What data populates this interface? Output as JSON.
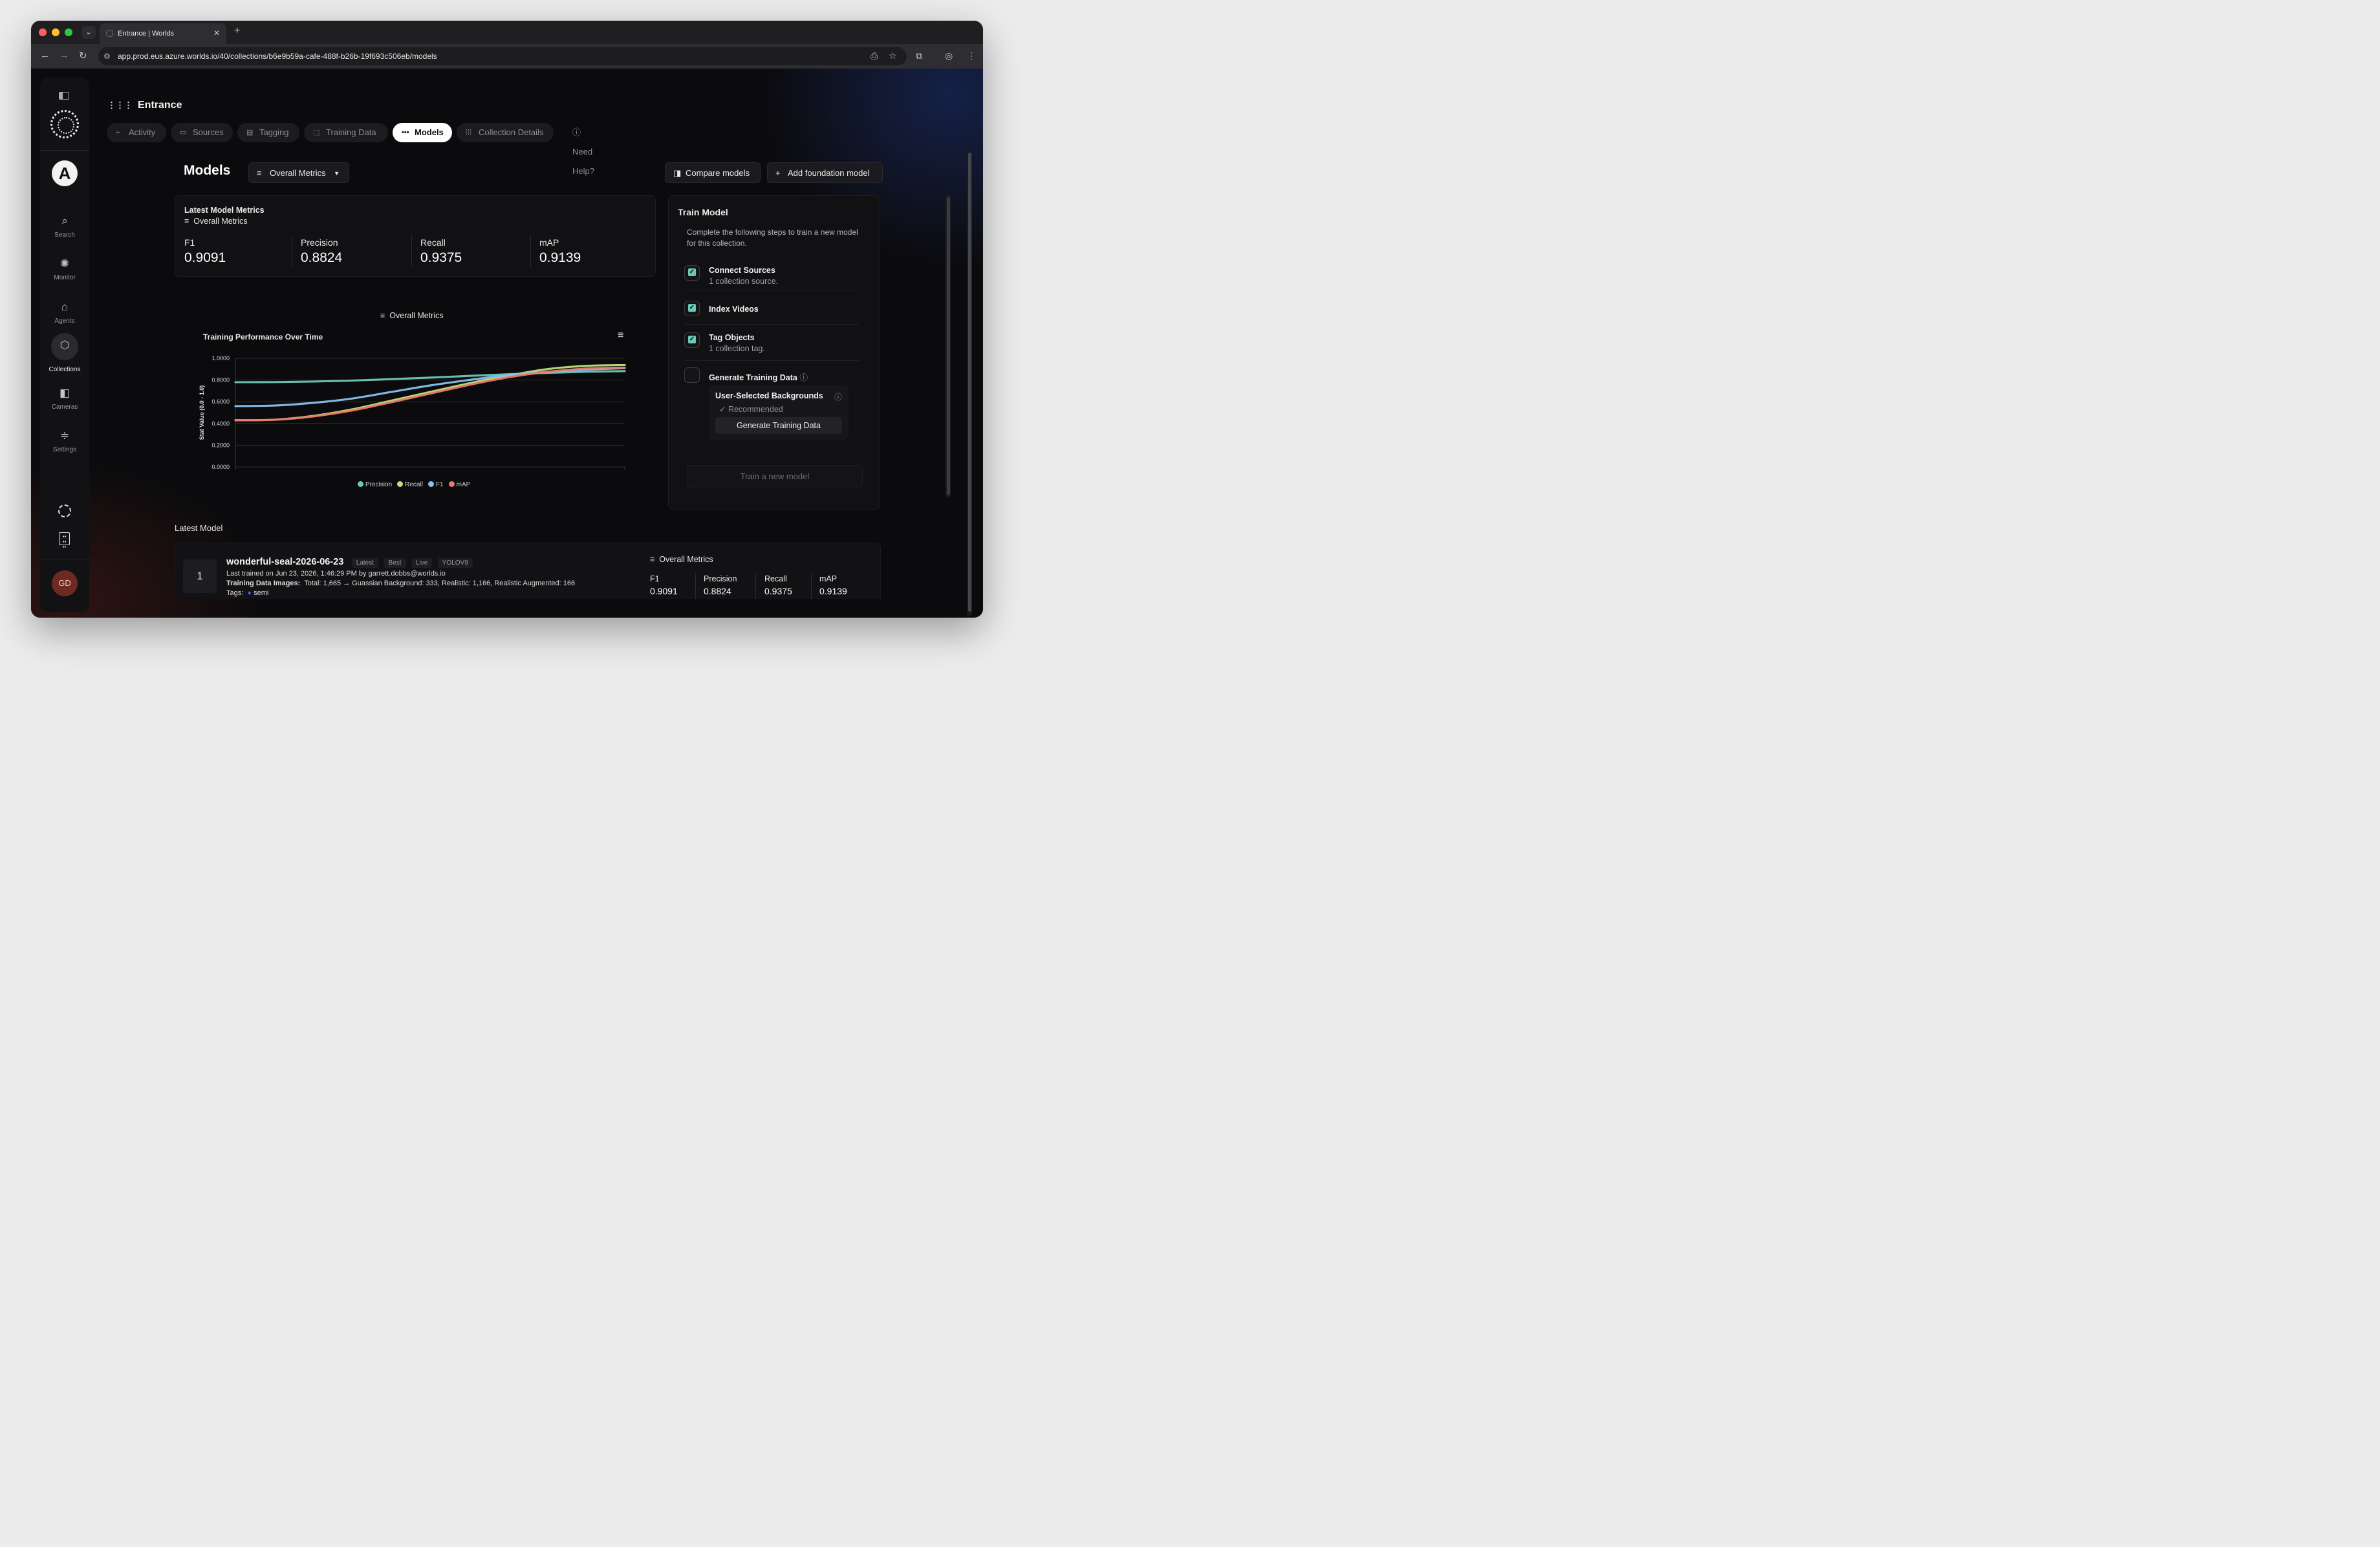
{
  "browser": {
    "tab_title": "Entrance | Worlds",
    "url": "app.prod.eus.azure.worlds.io/40/collections/b6e9b59a-cafe-488f-b26b-19f693c506eb/models"
  },
  "sidebar": {
    "items": [
      {
        "label": "Search"
      },
      {
        "label": "Monitor"
      },
      {
        "label": "Agents"
      },
      {
        "label": "Collections"
      },
      {
        "label": "Cameras"
      },
      {
        "label": "Settings"
      }
    ],
    "workspace_avatar": "A",
    "user_initials": "GD"
  },
  "app": {
    "title": "Entrance",
    "tabs": [
      "Activity",
      "Sources",
      "Tagging",
      "Training Data",
      "Models",
      "Collection Details"
    ],
    "active_tab": "Models",
    "help": "Need Help?"
  },
  "models": {
    "heading": "Models",
    "metrics_select": "Overall Metrics",
    "compare_button": "Compare models",
    "add_button": "Add foundation model"
  },
  "latest_metrics": {
    "title": "Latest Model Metrics",
    "subtitle": "Overall Metrics",
    "items": [
      {
        "label": "F1",
        "value": "0.9091"
      },
      {
        "label": "Precision",
        "value": "0.8824"
      },
      {
        "label": "Recall",
        "value": "0.9375"
      },
      {
        "label": "mAP",
        "value": "0.9139"
      }
    ]
  },
  "chart_header": "Overall Metrics",
  "chart_data": {
    "type": "line",
    "title": "Training Performance Over Time",
    "ylabel": "Stat Value (0.0 - 1.0)",
    "ylim": [
      0,
      1
    ],
    "yticks": [
      "1.0000",
      "0.8000",
      "0.6000",
      "0.4000",
      "0.2000",
      "0.0000"
    ],
    "x": [
      0,
      0.1,
      0.2,
      0.3,
      0.4,
      0.5,
      0.6,
      0.7,
      0.8,
      0.9,
      1.0
    ],
    "legend_position": "bottom",
    "grid": true,
    "series": [
      {
        "name": "Precision",
        "color": "#6fc7b7",
        "values": [
          0.78,
          0.781,
          0.786,
          0.795,
          0.808,
          0.822,
          0.838,
          0.853,
          0.866,
          0.876,
          0.882
        ]
      },
      {
        "name": "Recall",
        "color": "#bfe07a",
        "values": [
          0.43,
          0.435,
          0.47,
          0.53,
          0.61,
          0.69,
          0.77,
          0.84,
          0.9,
          0.93,
          0.938
        ]
      },
      {
        "name": "F1",
        "color": "#86c1ef",
        "values": [
          0.56,
          0.565,
          0.59,
          0.63,
          0.69,
          0.75,
          0.8,
          0.845,
          0.875,
          0.895,
          0.909
        ]
      },
      {
        "name": "mAP",
        "color": "#ea7a6c",
        "values": [
          0.43,
          0.434,
          0.465,
          0.52,
          0.595,
          0.675,
          0.755,
          0.825,
          0.875,
          0.905,
          0.914
        ]
      }
    ]
  },
  "train_model": {
    "title": "Train Model",
    "description": "Complete the following steps to train a new model for this collection.",
    "steps": [
      {
        "title": "Connect Sources",
        "subtitle": "1 collection source.",
        "done": true
      },
      {
        "title": "Index Videos",
        "subtitle": "",
        "done": true
      },
      {
        "title": "Tag Objects",
        "subtitle": "1 collection tag.",
        "done": true
      },
      {
        "title": "Generate Training Data",
        "subtitle": "",
        "done": false
      }
    ],
    "backgrounds_title": "User-Selected Backgrounds",
    "recommended": "Recommended",
    "generate_button": "Generate Training Data",
    "train_button": "Train a new model"
  },
  "latest_model": {
    "section_title": "Latest Model",
    "rank": "1",
    "name": "wonderful-seal-2026-06-23",
    "badges": [
      "Latest",
      "Best",
      "Live",
      "YOLOV9"
    ],
    "last_trained": "Last trained on Jun 23, 2026, 1:46:29 PM by garrett.dobbs@worlds.io",
    "training_images_label": "Training Data Images:",
    "training_images": "Total: 1,665 → Guassian Background: 333, Realistic: 1,166, Realistic Augmented: 166",
    "tags_label": "Tags:",
    "tag": "semi",
    "metrics_title": "Overall Metrics",
    "metrics": [
      {
        "label": "F1",
        "value": "0.9091"
      },
      {
        "label": "Precision",
        "value": "0.8824"
      },
      {
        "label": "Recall",
        "value": "0.9375"
      },
      {
        "label": "mAP",
        "value": "0.9139"
      }
    ]
  }
}
